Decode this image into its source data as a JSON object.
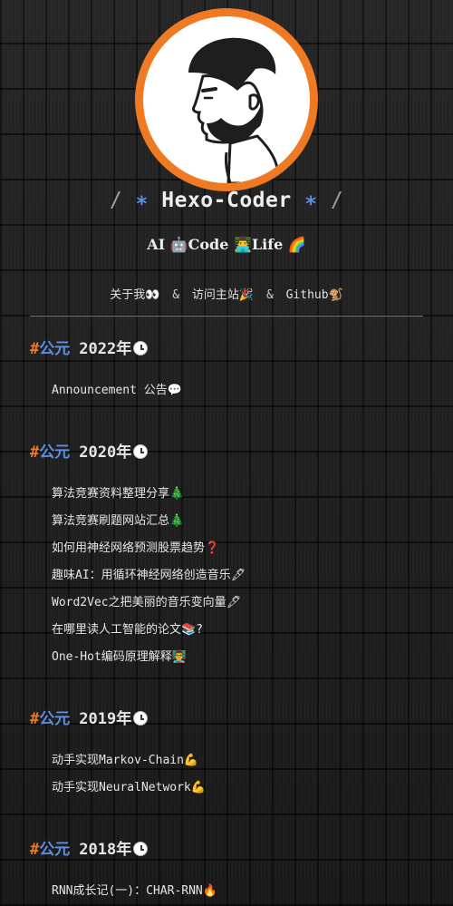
{
  "header": {
    "title_prefix": "/",
    "title_star": "∗",
    "title": "Hexo-Coder",
    "title_suffix": "/",
    "subtitle": "AI 🤖Code 👨‍💻Life 🌈"
  },
  "nav": {
    "about": "关于我👀",
    "sep": "&",
    "home": "访问主站🎉",
    "github": "Github🐒"
  },
  "archive": [
    {
      "hash": "#",
      "era": "公元",
      "year": "2022年",
      "posts": [
        "Announcement 公告💬"
      ]
    },
    {
      "hash": "#",
      "era": "公元",
      "year": "2020年",
      "posts": [
        "算法竞赛资料整理分享🎄",
        "算法竞赛刷题网站汇总🎄",
        "如何用神经网络预测股票趋势❓",
        "趣味AI：用循环神经网络创造音乐🖋",
        "Word2Vec之把美丽的音乐变向量🖋",
        "在哪里读人工智能的论文📚?",
        "One-Hot编码原理解释👨‍🏫"
      ]
    },
    {
      "hash": "#",
      "era": "公元",
      "year": "2019年",
      "posts": [
        "动手实现Markov-Chain💪",
        "动手实现NeuralNetwork💪"
      ]
    },
    {
      "hash": "#",
      "era": "公元",
      "year": "2018年",
      "posts": [
        "RNN成长记(一)：CHAR-RNN🔥"
      ]
    }
  ],
  "colors": {
    "accent_orange": "#f07a23",
    "accent_blue": "#5b8fe0",
    "background": "#1c1c1c"
  }
}
